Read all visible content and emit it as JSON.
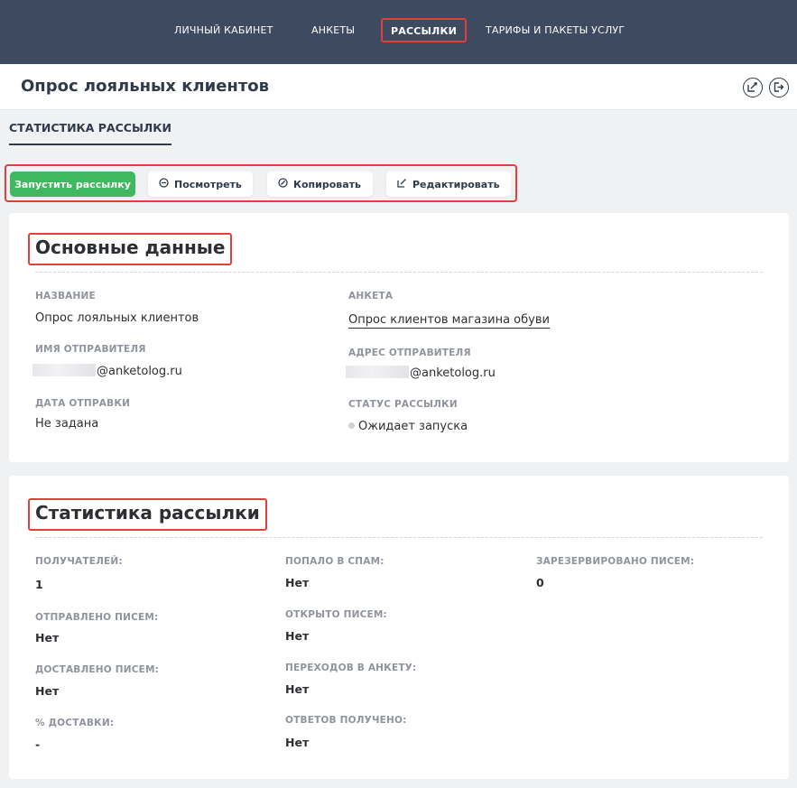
{
  "nav": {
    "items": [
      "ЛИЧНЫЙ КАБИНЕТ",
      "АНКЕТЫ",
      "РАССЫЛКИ",
      "ТАРИФЫ И ПАКЕТЫ УСЛУГ"
    ],
    "active": "РАССЫЛКИ"
  },
  "header": {
    "title": "Опрос лояльных клиентов",
    "icons": [
      "edit-icon",
      "logout-icon"
    ]
  },
  "section_tab": "СТАТИСТИКА РАССЫЛКИ",
  "actions": {
    "launch": "Запустить рассылку",
    "view": "Посмотреть",
    "copy": "Копировать",
    "edit": "Редактировать"
  },
  "main_info": {
    "title": "Основные данные",
    "name_label": "НАЗВАНИЕ",
    "name_value": "Опрос лояльных клиентов",
    "survey_label": "АНКЕТА",
    "survey_value": "Опрос клиентов магазина обуви",
    "sender_name_label": "ИМЯ ОТПРАВИТЕЛЯ",
    "sender_name_value": "@anketolog.ru",
    "sender_address_label": "АДРЕС ОТПРАВИТЕЛЯ",
    "sender_address_value": "@anketolog.ru",
    "send_date_label": "ДАТА ОТПРАВКИ",
    "send_date_value": "Не задана",
    "status_label": "СТАТУС РАССЫЛКИ",
    "status_value": "Ожидает запуска"
  },
  "stats": {
    "title": "Статистика рассылки",
    "recipients_label": "ПОЛУЧАТЕЛЕЙ:",
    "recipients_value": "1",
    "spam_label": "ПОПАЛО В СПАМ:",
    "spam_value": "Нет",
    "reserved_label": "ЗАРЕЗЕРВИРОВАНО ПИСЕМ:",
    "reserved_value": "0",
    "sent_label": "ОТПРАВЛЕНО ПИСЕМ:",
    "sent_value": "Нет",
    "opened_label": "ОТКРЫТО ПИСЕМ:",
    "opened_value": "Нет",
    "delivered_label": "ДОСТАВЛЕНО ПИСЕМ:",
    "delivered_value": "Нет",
    "clicks_label": "ПЕРЕХОДОВ В АНКЕТУ:",
    "clicks_value": "Нет",
    "delivery_pct_label": "% ДОСТАВКИ:",
    "delivery_pct_value": "-",
    "answers_label": "ОТВЕТОВ ПОЛУЧЕНО:",
    "answers_value": "Нет"
  },
  "colors": {
    "nav_bg": "#3d4a60",
    "primary_button": "#3fb85f",
    "highlight": "#e0403a",
    "page_bg": "#f0f1f3"
  }
}
